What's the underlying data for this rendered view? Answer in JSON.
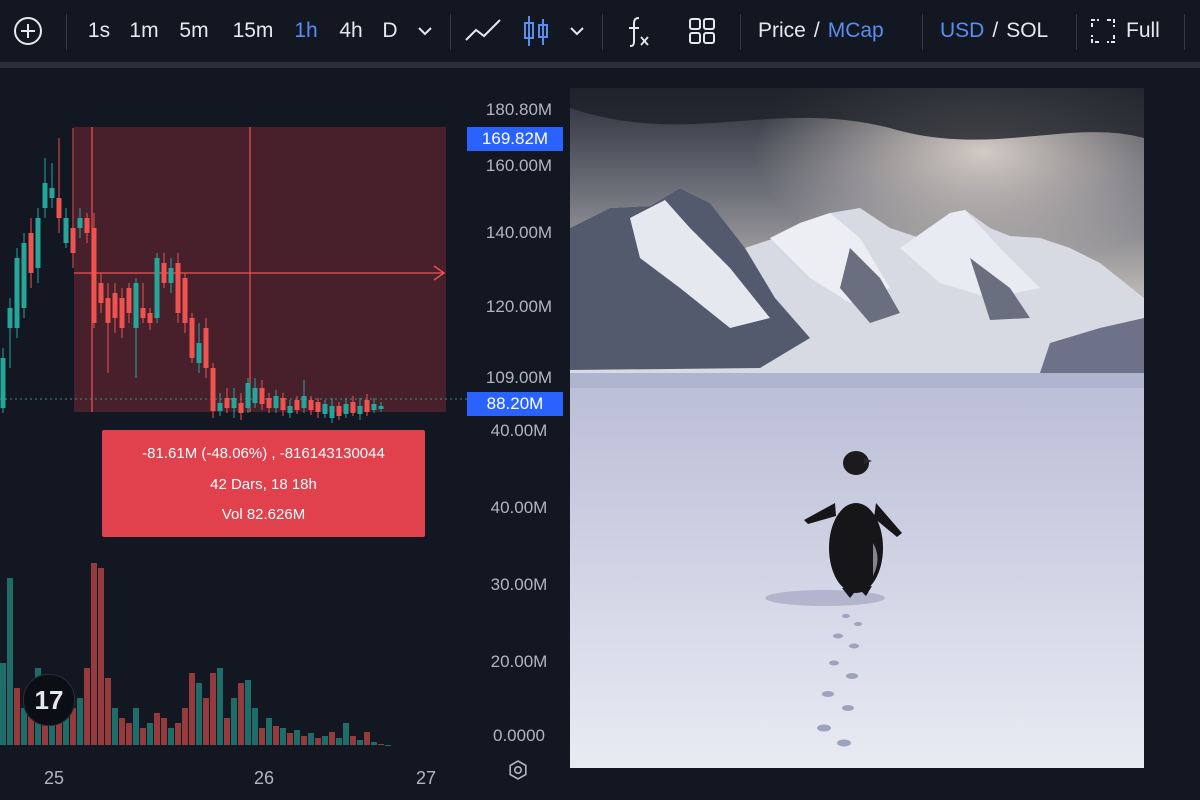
{
  "toolbar": {
    "intervals": [
      "1s",
      "1m",
      "5m",
      "15m",
      "1h",
      "4h",
      "D"
    ],
    "active_interval": "1h",
    "price_label": "Price",
    "mcap_label": "MCap",
    "usd_label": "USD",
    "sol_label": "SOL",
    "slash": "/",
    "full_label": "Full",
    "icons": [
      "add-icon",
      "chevron-down-icon",
      "line-chart-icon",
      "candlestick-icon",
      "fx-icon",
      "grid-icon",
      "fullscreen-icon"
    ]
  },
  "y_axis": {
    "ticks": [
      "180.80M",
      "160.00M",
      "140.00M",
      "120.00M",
      "109.00M",
      "40.00M",
      "40.00M",
      "30.00M",
      "20.00M",
      "0.0000"
    ],
    "top_tag": "169.82M",
    "current_tag": "88.20M"
  },
  "x_axis": {
    "ticks": [
      "25",
      "26",
      "27"
    ]
  },
  "measure_tooltip": {
    "line1": "-81.61M (-48.06%) , -816143130044",
    "line2": "42 Dars, 18 18h",
    "line3": "Vol 82.626M"
  },
  "watermark": {
    "text": "17"
  },
  "colors": {
    "up": "#26a69a",
    "down": "#ef5350",
    "accent": "#2962ff",
    "background": "#131722",
    "measure": "#e0414d"
  }
}
